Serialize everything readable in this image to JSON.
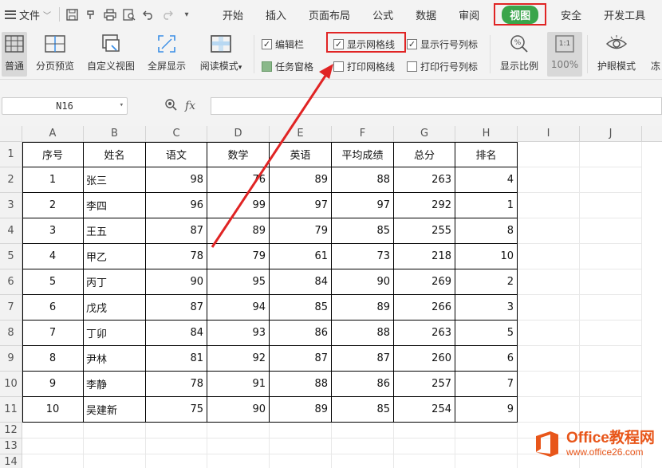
{
  "menubar": {
    "file_label": "文件",
    "tabs": [
      {
        "label": "开始"
      },
      {
        "label": "插入"
      },
      {
        "label": "页面布局"
      },
      {
        "label": "公式"
      },
      {
        "label": "数据"
      },
      {
        "label": "审阅"
      },
      {
        "label": "视图",
        "active": true
      },
      {
        "label": "安全"
      },
      {
        "label": "开发工具"
      }
    ]
  },
  "ribbon": {
    "normal": "普通",
    "page_break": "分页预览",
    "custom_view": "自定义视图",
    "fullscreen": "全屏显示",
    "reading_mode": "阅读模式",
    "checkboxes": {
      "edit_bar": {
        "label": "编辑栏",
        "checked": true
      },
      "show_gridlines": {
        "label": "显示网格线",
        "checked": true
      },
      "show_headings": {
        "label": "显示行号列标",
        "checked": true
      },
      "task_pane": {
        "label": "任务窗格",
        "checked": true
      },
      "print_gridlines": {
        "label": "打印网格线",
        "checked": false
      },
      "print_headings": {
        "label": "打印行号列标",
        "checked": false
      }
    },
    "zoom": "显示比例",
    "zoom_100": "100%",
    "zoom_100_icon": "1:1",
    "eye_mode": "护眼模式",
    "more": "冻"
  },
  "formula_bar": {
    "name_box": "N16",
    "fx": "fx"
  },
  "sheet": {
    "columns": [
      "A",
      "B",
      "C",
      "D",
      "E",
      "F",
      "G",
      "H",
      "I",
      "J"
    ],
    "rows": [
      "1",
      "2",
      "3",
      "4",
      "5",
      "6",
      "7",
      "8",
      "9",
      "10",
      "11",
      "12",
      "13",
      "14"
    ],
    "header": [
      "序号",
      "姓名",
      "语文",
      "数学",
      "英语",
      "平均成绩",
      "总分",
      "排名"
    ],
    "data": [
      [
        "1",
        "张三",
        "98",
        "76",
        "89",
        "88",
        "263",
        "4"
      ],
      [
        "2",
        "李四",
        "96",
        "99",
        "97",
        "97",
        "292",
        "1"
      ],
      [
        "3",
        "王五",
        "87",
        "89",
        "79",
        "85",
        "255",
        "8"
      ],
      [
        "4",
        "甲乙",
        "78",
        "79",
        "61",
        "73",
        "218",
        "10"
      ],
      [
        "5",
        "丙丁",
        "90",
        "95",
        "84",
        "90",
        "269",
        "2"
      ],
      [
        "6",
        "戊戌",
        "87",
        "94",
        "85",
        "89",
        "266",
        "3"
      ],
      [
        "7",
        "丁卯",
        "84",
        "93",
        "86",
        "88",
        "263",
        "5"
      ],
      [
        "8",
        "尹林",
        "81",
        "92",
        "87",
        "87",
        "260",
        "6"
      ],
      [
        "9",
        "李静",
        "78",
        "91",
        "88",
        "86",
        "257",
        "7"
      ],
      [
        "10",
        "吴建新",
        "75",
        "90",
        "89",
        "85",
        "254",
        "9"
      ]
    ]
  },
  "watermark": {
    "line1": "Office教程网",
    "line2": "www.office26.com"
  },
  "colors": {
    "accent_green": "#3aa54b",
    "highlight_red": "#e02424",
    "watermark_orange": "#e8561a"
  }
}
